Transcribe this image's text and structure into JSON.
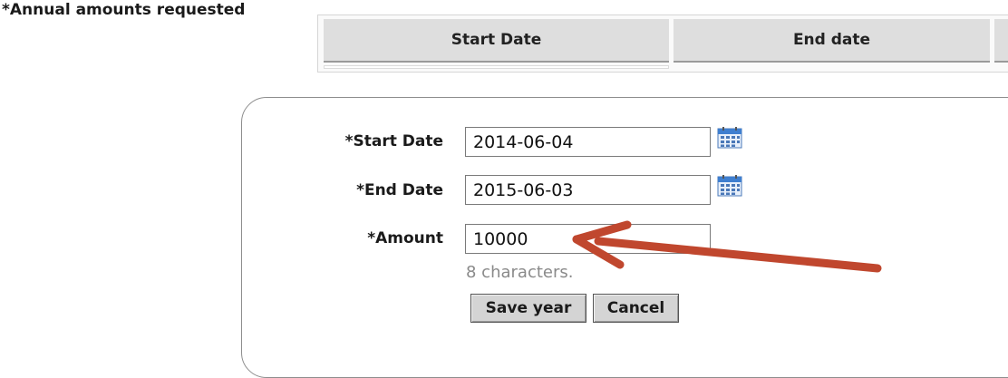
{
  "section": {
    "heading": "*Annual amounts requested"
  },
  "table": {
    "columns": [
      "Start Date",
      "End date"
    ]
  },
  "form": {
    "start_date": {
      "label": "*Start Date",
      "value": "2014-06-04",
      "icon": "calendar-icon"
    },
    "end_date": {
      "label": "*End Date",
      "value": "2015-06-03",
      "icon": "calendar-icon"
    },
    "amount": {
      "label": "*Amount",
      "value": "10000",
      "hint": "8 characters."
    },
    "buttons": {
      "save": "Save year",
      "cancel": "Cancel"
    }
  },
  "annotation": {
    "arrow_color": "#c0472e"
  }
}
